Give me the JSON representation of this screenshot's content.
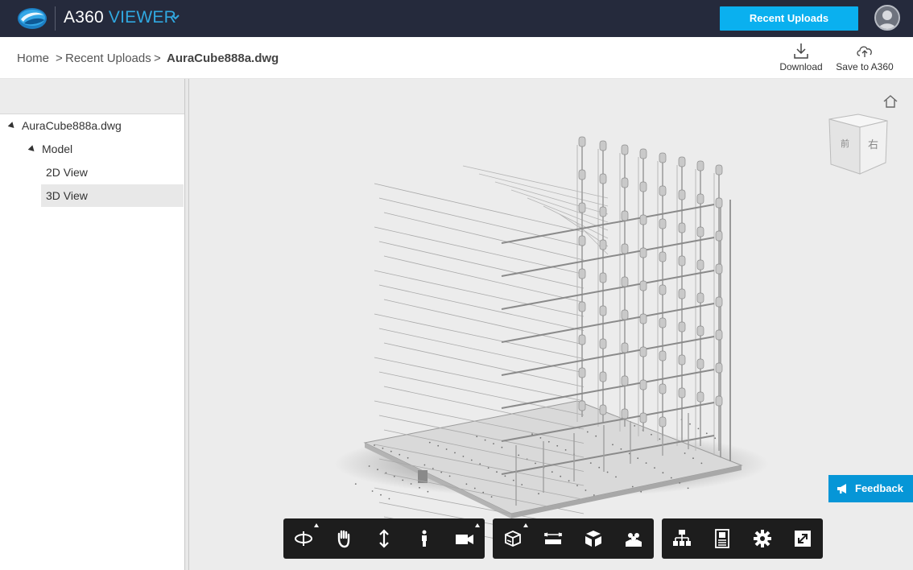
{
  "header": {
    "app_name": "A360",
    "app_suffix": "VIEWER",
    "recent_uploads_label": "Recent Uploads"
  },
  "breadcrumb": {
    "home": "Home",
    "separator": ">",
    "recent": "Recent Uploads",
    "current": "AuraCube888a.dwg"
  },
  "actions": {
    "download_label": "Download",
    "save_label": "Save to A360"
  },
  "tree": {
    "root": "AuraCube888a.dwg",
    "model": "Model",
    "view2d": "2D View",
    "view3d": "3D View",
    "selected": "3D View"
  },
  "viewcube": {
    "front_face": "前",
    "right_face": "右"
  },
  "feedback_label": "Feedback",
  "toolbars": {
    "navigation": [
      "orbit-icon",
      "pan-icon",
      "zoom-icon",
      "first-person-icon",
      "camera-icon"
    ],
    "modeling": [
      "section-icon",
      "measure-icon",
      "explode-icon",
      "model-browser-icon"
    ],
    "settings": [
      "structure-icon",
      "properties-icon",
      "settings-icon",
      "fullscreen-icon"
    ]
  },
  "colors": {
    "topbar": "#252a3c",
    "accent": "#0ab0ef",
    "viewer_text": "#30a8e0",
    "feedback": "#0696d7",
    "toolbar": "#1d1d1d",
    "viewport": "#ececec"
  }
}
